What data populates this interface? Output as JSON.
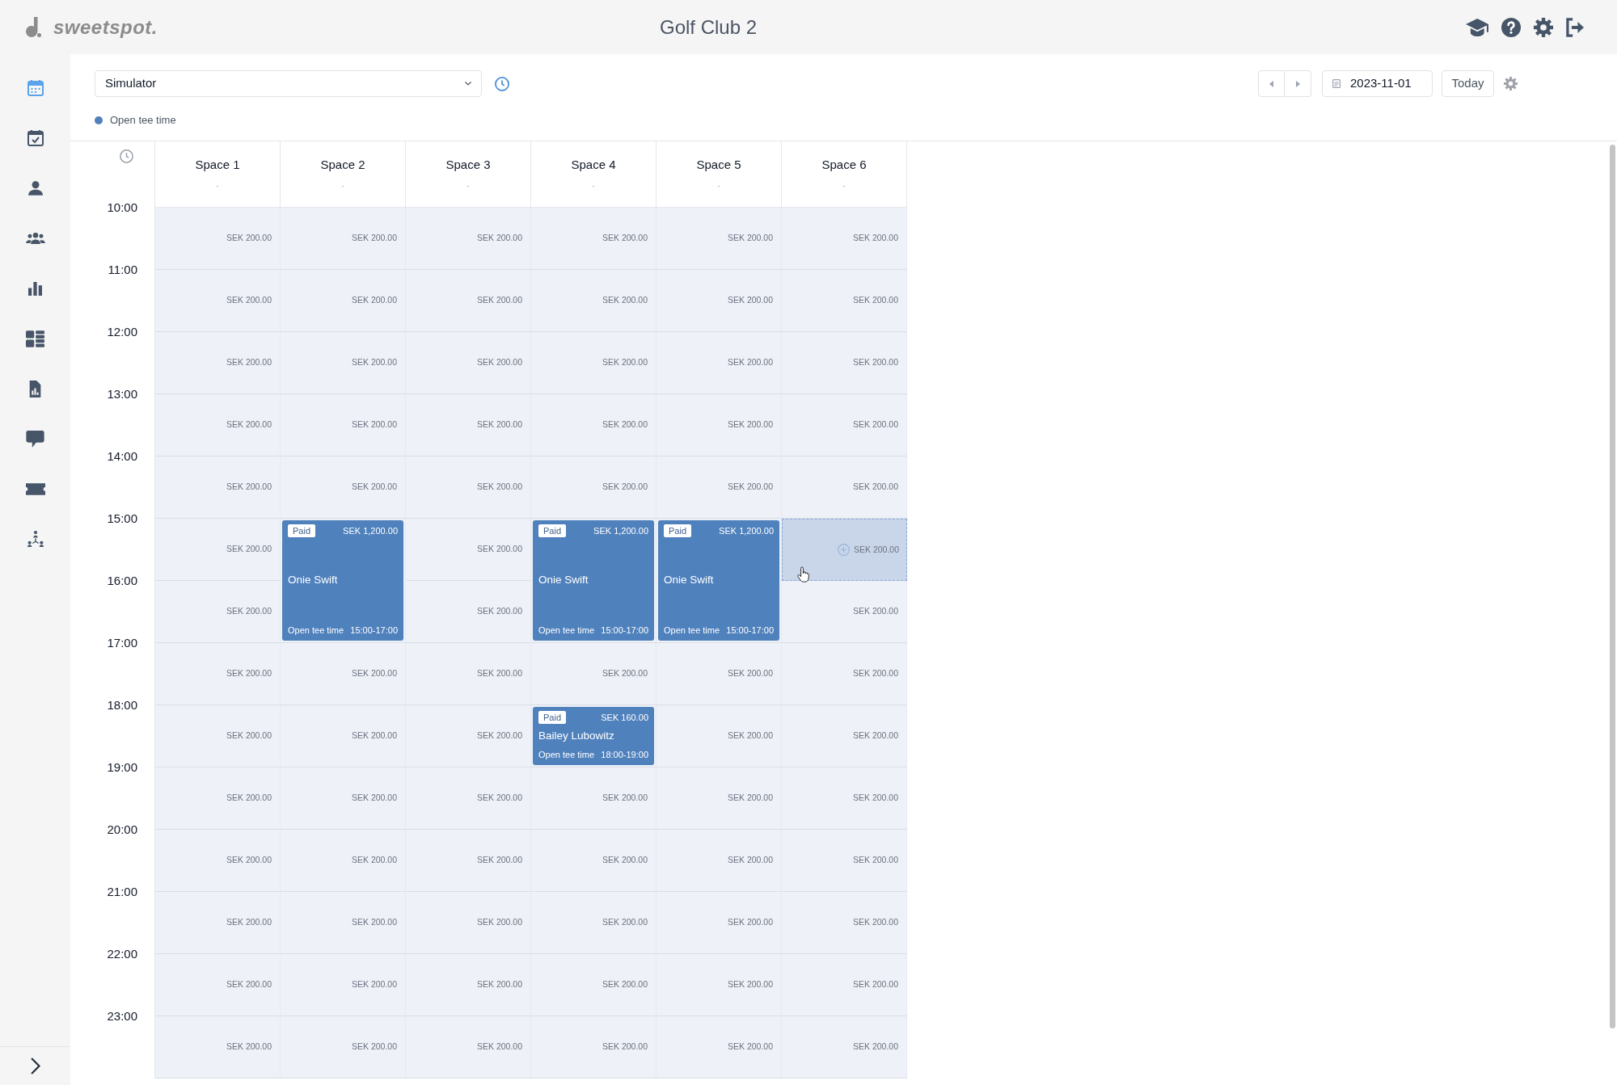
{
  "header": {
    "logo": "sweetspot.",
    "title": "Golf Club 2"
  },
  "sidebar": {
    "items": [
      {
        "selected": true
      },
      {
        "selected": false
      },
      {
        "selected": false
      },
      {
        "selected": false
      },
      {
        "selected": false
      },
      {
        "selected": false
      },
      {
        "selected": false
      },
      {
        "selected": false
      },
      {
        "selected": false
      },
      {
        "selected": false
      }
    ]
  },
  "toolbar": {
    "resource_select": {
      "value": "Simulator"
    },
    "date_field": {
      "value": "2023-11-01"
    },
    "today_button": "Today",
    "legend": [
      {
        "label": "Open tee time",
        "color": "#4f81bd"
      }
    ]
  },
  "calendar": {
    "columns": [
      {
        "name": "Space 1",
        "subtitle": "-"
      },
      {
        "name": "Space 2",
        "subtitle": "-"
      },
      {
        "name": "Space 3",
        "subtitle": "-"
      },
      {
        "name": "Space 4",
        "subtitle": "-"
      },
      {
        "name": "Space 5",
        "subtitle": "-"
      },
      {
        "name": "Space 6",
        "subtitle": "-"
      }
    ],
    "rows": [
      {
        "time": "10:00",
        "cells": [
          {
            "kind": "slot",
            "price": "SEK 200.00",
            "hovered": false
          },
          {
            "kind": "slot",
            "price": "SEK 200.00",
            "hovered": false
          },
          {
            "kind": "slot",
            "price": "SEK 200.00",
            "hovered": false
          },
          {
            "kind": "slot",
            "price": "SEK 200.00",
            "hovered": false
          },
          {
            "kind": "slot",
            "price": "SEK 200.00",
            "hovered": false
          },
          {
            "kind": "slot",
            "price": "SEK 200.00",
            "hovered": false
          }
        ]
      },
      {
        "time": "11:00",
        "cells": [
          {
            "kind": "slot",
            "price": "SEK 200.00",
            "hovered": false
          },
          {
            "kind": "slot",
            "price": "SEK 200.00",
            "hovered": false
          },
          {
            "kind": "slot",
            "price": "SEK 200.00",
            "hovered": false
          },
          {
            "kind": "slot",
            "price": "SEK 200.00",
            "hovered": false
          },
          {
            "kind": "slot",
            "price": "SEK 200.00",
            "hovered": false
          },
          {
            "kind": "slot",
            "price": "SEK 200.00",
            "hovered": false
          }
        ]
      },
      {
        "time": "12:00",
        "cells": [
          {
            "kind": "slot",
            "price": "SEK 200.00",
            "hovered": false
          },
          {
            "kind": "slot",
            "price": "SEK 200.00",
            "hovered": false
          },
          {
            "kind": "slot",
            "price": "SEK 200.00",
            "hovered": false
          },
          {
            "kind": "slot",
            "price": "SEK 200.00",
            "hovered": false
          },
          {
            "kind": "slot",
            "price": "SEK 200.00",
            "hovered": false
          },
          {
            "kind": "slot",
            "price": "SEK 200.00",
            "hovered": false
          }
        ]
      },
      {
        "time": "13:00",
        "cells": [
          {
            "kind": "slot",
            "price": "SEK 200.00",
            "hovered": false
          },
          {
            "kind": "slot",
            "price": "SEK 200.00",
            "hovered": false
          },
          {
            "kind": "slot",
            "price": "SEK 200.00",
            "hovered": false
          },
          {
            "kind": "slot",
            "price": "SEK 200.00",
            "hovered": false
          },
          {
            "kind": "slot",
            "price": "SEK 200.00",
            "hovered": false
          },
          {
            "kind": "slot",
            "price": "SEK 200.00",
            "hovered": false
          }
        ]
      },
      {
        "time": "14:00",
        "cells": [
          {
            "kind": "slot",
            "price": "SEK 200.00",
            "hovered": false
          },
          {
            "kind": "slot",
            "price": "SEK 200.00",
            "hovered": false
          },
          {
            "kind": "slot",
            "price": "SEK 200.00",
            "hovered": false
          },
          {
            "kind": "slot",
            "price": "SEK 200.00",
            "hovered": false
          },
          {
            "kind": "slot",
            "price": "SEK 200.00",
            "hovered": false
          },
          {
            "kind": "slot",
            "price": "SEK 200.00",
            "hovered": false
          }
        ]
      },
      {
        "time": "15:00",
        "cells": [
          {
            "kind": "slot",
            "price": "SEK 200.00",
            "hovered": false
          },
          {
            "kind": "booking",
            "status": "Paid",
            "amount": "SEK 1,200.00",
            "name": "Onie Swift",
            "type": "Open tee time",
            "time": "15:00-17:00",
            "color": "#4f81bd"
          },
          {
            "kind": "slot",
            "price": "SEK 200.00",
            "hovered": false
          },
          {
            "kind": "booking",
            "status": "Paid",
            "amount": "SEK 1,200.00",
            "name": "Onie Swift",
            "type": "Open tee time",
            "time": "15:00-17:00",
            "color": "#4f81bd"
          },
          {
            "kind": "booking",
            "status": "Paid",
            "amount": "SEK 1,200.00",
            "name": "Onie Swift",
            "type": "Open tee time",
            "time": "15:00-17:00",
            "color": "#4f81bd"
          },
          {
            "kind": "slot",
            "price": "SEK 200.00",
            "hovered": true
          }
        ]
      },
      {
        "time": "16:00",
        "cells": [
          {
            "kind": "slot",
            "price": "SEK 200.00",
            "hovered": false
          },
          {
            "kind": "continued"
          },
          {
            "kind": "slot",
            "price": "SEK 200.00",
            "hovered": false
          },
          {
            "kind": "continued"
          },
          {
            "kind": "continued"
          },
          {
            "kind": "slot",
            "price": "SEK 200.00",
            "hovered": false
          }
        ]
      },
      {
        "time": "17:00",
        "cells": [
          {
            "kind": "slot",
            "price": "SEK 200.00",
            "hovered": false
          },
          {
            "kind": "slot",
            "price": "SEK 200.00",
            "hovered": false
          },
          {
            "kind": "slot",
            "price": "SEK 200.00",
            "hovered": false
          },
          {
            "kind": "slot",
            "price": "SEK 200.00",
            "hovered": false
          },
          {
            "kind": "slot",
            "price": "SEK 200.00",
            "hovered": false
          },
          {
            "kind": "slot",
            "price": "SEK 200.00",
            "hovered": false
          }
        ]
      },
      {
        "time": "18:00",
        "cells": [
          {
            "kind": "slot",
            "price": "SEK 200.00",
            "hovered": false
          },
          {
            "kind": "slot",
            "price": "SEK 200.00",
            "hovered": false
          },
          {
            "kind": "slot",
            "price": "SEK 200.00",
            "hovered": false
          },
          {
            "kind": "booking",
            "status": "Paid",
            "amount": "SEK 160.00",
            "name": "Bailey Lubowitz",
            "type": "Open tee time",
            "time": "18:00-19:00",
            "color": "#4f81bd"
          },
          {
            "kind": "slot",
            "price": "SEK 200.00",
            "hovered": false
          },
          {
            "kind": "slot",
            "price": "SEK 200.00",
            "hovered": false
          }
        ]
      },
      {
        "time": "19:00",
        "cells": [
          {
            "kind": "slot",
            "price": "SEK 200.00",
            "hovered": false
          },
          {
            "kind": "slot",
            "price": "SEK 200.00",
            "hovered": false
          },
          {
            "kind": "slot",
            "price": "SEK 200.00",
            "hovered": false
          },
          {
            "kind": "slot",
            "price": "SEK 200.00",
            "hovered": false
          },
          {
            "kind": "slot",
            "price": "SEK 200.00",
            "hovered": false
          },
          {
            "kind": "slot",
            "price": "SEK 200.00",
            "hovered": false
          }
        ]
      },
      {
        "time": "20:00",
        "cells": [
          {
            "kind": "slot",
            "price": "SEK 200.00",
            "hovered": false
          },
          {
            "kind": "slot",
            "price": "SEK 200.00",
            "hovered": false
          },
          {
            "kind": "slot",
            "price": "SEK 200.00",
            "hovered": false
          },
          {
            "kind": "slot",
            "price": "SEK 200.00",
            "hovered": false
          },
          {
            "kind": "slot",
            "price": "SEK 200.00",
            "hovered": false
          },
          {
            "kind": "slot",
            "price": "SEK 200.00",
            "hovered": false
          }
        ]
      },
      {
        "time": "21:00",
        "cells": [
          {
            "kind": "slot",
            "price": "SEK 200.00",
            "hovered": false
          },
          {
            "kind": "slot",
            "price": "SEK 200.00",
            "hovered": false
          },
          {
            "kind": "slot",
            "price": "SEK 200.00",
            "hovered": false
          },
          {
            "kind": "slot",
            "price": "SEK 200.00",
            "hovered": false
          },
          {
            "kind": "slot",
            "price": "SEK 200.00",
            "hovered": false
          },
          {
            "kind": "slot",
            "price": "SEK 200.00",
            "hovered": false
          }
        ]
      },
      {
        "time": "22:00",
        "cells": [
          {
            "kind": "slot",
            "price": "SEK 200.00",
            "hovered": false
          },
          {
            "kind": "slot",
            "price": "SEK 200.00",
            "hovered": false
          },
          {
            "kind": "slot",
            "price": "SEK 200.00",
            "hovered": false
          },
          {
            "kind": "slot",
            "price": "SEK 200.00",
            "hovered": false
          },
          {
            "kind": "slot",
            "price": "SEK 200.00",
            "hovered": false
          },
          {
            "kind": "slot",
            "price": "SEK 200.00",
            "hovered": false
          }
        ]
      },
      {
        "time": "23:00",
        "cells": [
          {
            "kind": "slot",
            "price": "SEK 200.00",
            "hovered": false
          },
          {
            "kind": "slot",
            "price": "SEK 200.00",
            "hovered": false
          },
          {
            "kind": "slot",
            "price": "SEK 200.00",
            "hovered": false
          },
          {
            "kind": "slot",
            "price": "SEK 200.00",
            "hovered": false
          },
          {
            "kind": "slot",
            "price": "SEK 200.00",
            "hovered": false
          },
          {
            "kind": "slot",
            "price": "SEK 200.00",
            "hovered": false
          }
        ]
      }
    ]
  }
}
